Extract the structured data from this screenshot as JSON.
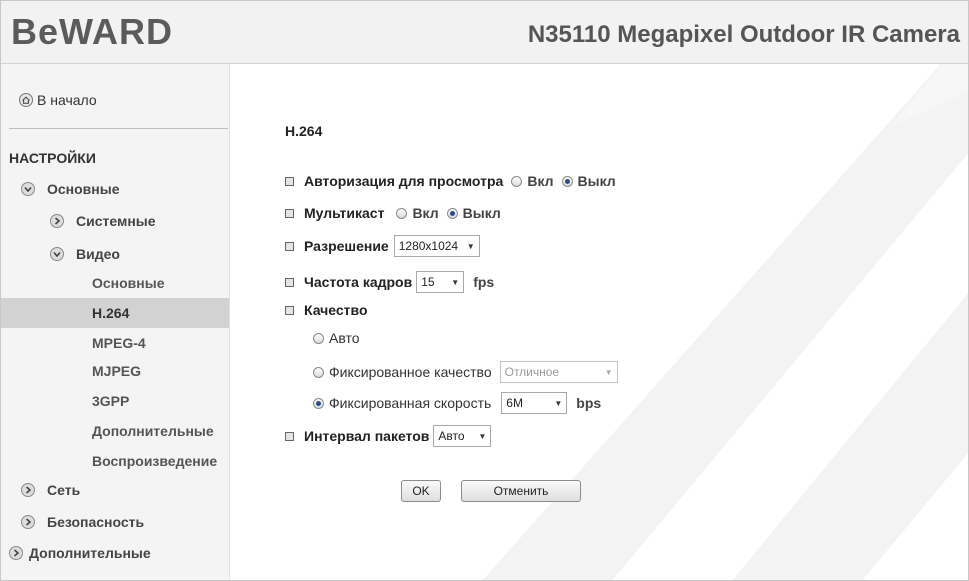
{
  "header": {
    "logo": "BeWARD",
    "camera_title": "N35110 Megapixel Outdoor IR Camera"
  },
  "sidebar": {
    "home_label": "В начало",
    "section_label": "НАСТРОЙКИ",
    "items": [
      {
        "label": "Основные",
        "state": "expanded"
      },
      {
        "label": "Системные",
        "state": "collapsed"
      },
      {
        "label": "Видео",
        "state": "expanded"
      },
      {
        "label": "Сеть",
        "state": "collapsed"
      },
      {
        "label": "Безопасность",
        "state": "collapsed"
      },
      {
        "label": "Дополнительные",
        "state": "collapsed"
      }
    ],
    "video_subitems": [
      "Основные",
      "H.264",
      "MPEG-4",
      "MJPEG",
      "3GPP",
      "Дополнительные",
      "Воспроизведение"
    ],
    "active_subitem": "H.264"
  },
  "main": {
    "title": "H.264",
    "auth": {
      "label": "Авторизация для просмотра",
      "on_label": "Вкл",
      "off_label": "Выкл",
      "selected": "off"
    },
    "multicast": {
      "label": "Мультикаст",
      "on_label": "Вкл",
      "off_label": "Выкл",
      "selected": "off"
    },
    "resolution": {
      "label": "Разрешение",
      "value": "1280x1024"
    },
    "framerate": {
      "label": "Частота кадров",
      "value": "15",
      "unit": "fps"
    },
    "quality": {
      "label": "Качество",
      "auto_label": "Авто",
      "fixed_quality_label": "Фиксированное качество",
      "fixed_quality_value": "Отличное",
      "fixed_rate_label": "Фиксированная скорость",
      "fixed_rate_value": "6M",
      "rate_unit": "bps",
      "selected": "fixed_rate"
    },
    "interval": {
      "label": "Интервал пакетов",
      "value": "Авто"
    },
    "ok_label": "OK",
    "cancel_label": "Отменить"
  },
  "colors": {
    "header_bg": "#f2f2f2",
    "sidebar_bg": "#f4f4f4",
    "active_item_bg": "#d2d2d2",
    "watermark": "#f1f1f1"
  }
}
